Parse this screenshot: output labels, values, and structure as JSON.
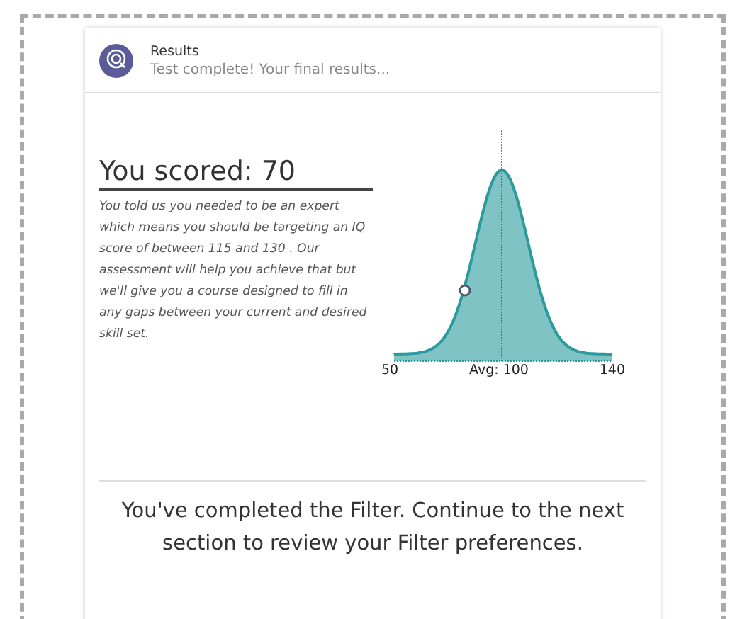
{
  "header": {
    "title": "Results",
    "subtitle": "Test complete! Your final results..."
  },
  "score": {
    "heading": "You scored: 70",
    "description": "You told us you needed to be an expert which means you should be targeting an IQ score of between 115 and 130 . Our assessment will help you achieve that but we'll give you a course designed to fill in any gaps between your current and desired skill set."
  },
  "distribution": {
    "axis_labels": [
      "50",
      "Avg: 100",
      "140"
    ]
  },
  "completion_message": "You've completed the Filter. Continue to the next section to review your Filter preferences."
}
